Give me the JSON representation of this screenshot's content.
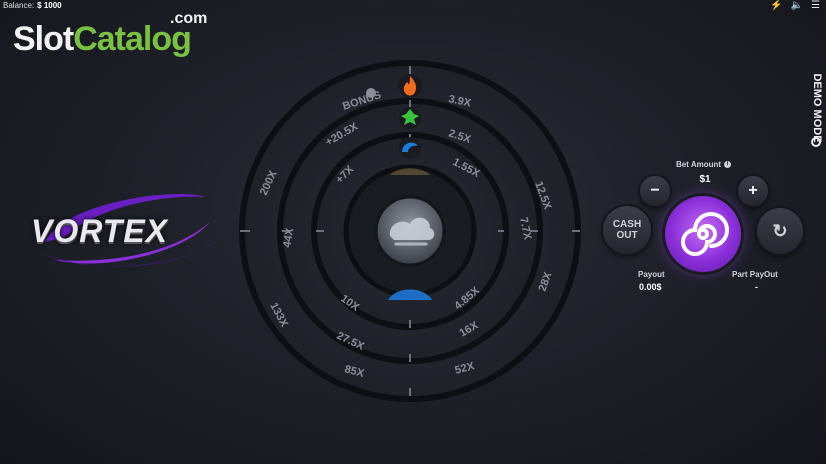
{
  "topbar": {
    "balance_label": "Balance:",
    "balance_value": "$ 1000",
    "icons": [
      "lightning-icon",
      "speaker-icon",
      "settings-icon"
    ]
  },
  "watermark": {
    "part1": "Slot",
    "part2": "Catalog",
    "suffix": ".com"
  },
  "game": {
    "title": "VORTEX"
  },
  "demo_mode": "DEMO MODE",
  "wheel": {
    "bonus_label": "BONUS",
    "outer_ring": [
      "3.9X",
      "12.5X",
      "28X",
      "52X",
      "85X",
      "133X",
      "200X"
    ],
    "middle_ring": [
      "2.5X",
      "7.7X",
      "16X",
      "27.5X",
      "44X",
      "+20.5X"
    ],
    "inner_ring": [
      "1.55X",
      "4.85X",
      "10X",
      "+7X"
    ],
    "center_icon": "wind-cloud-icon",
    "gem_icons": [
      "fire-icon",
      "leaf-icon",
      "water-icon"
    ]
  },
  "controls": {
    "bet_amount_label": "Bet Amount",
    "bet_value": "$1",
    "minus_label": "−",
    "plus_label": "+",
    "cash_out_line1": "CASH",
    "cash_out_line2": "OUT",
    "payout_label": "Payout",
    "payout_value": "0.00$",
    "part_payout_label": "Part PayOut",
    "part_payout_value": "-"
  },
  "colors": {
    "accent_purple": "#8a2fd9",
    "brand_green": "#7ac142",
    "fire": "#f36c1e",
    "leaf": "#38c23a",
    "water": "#1e78d6"
  }
}
